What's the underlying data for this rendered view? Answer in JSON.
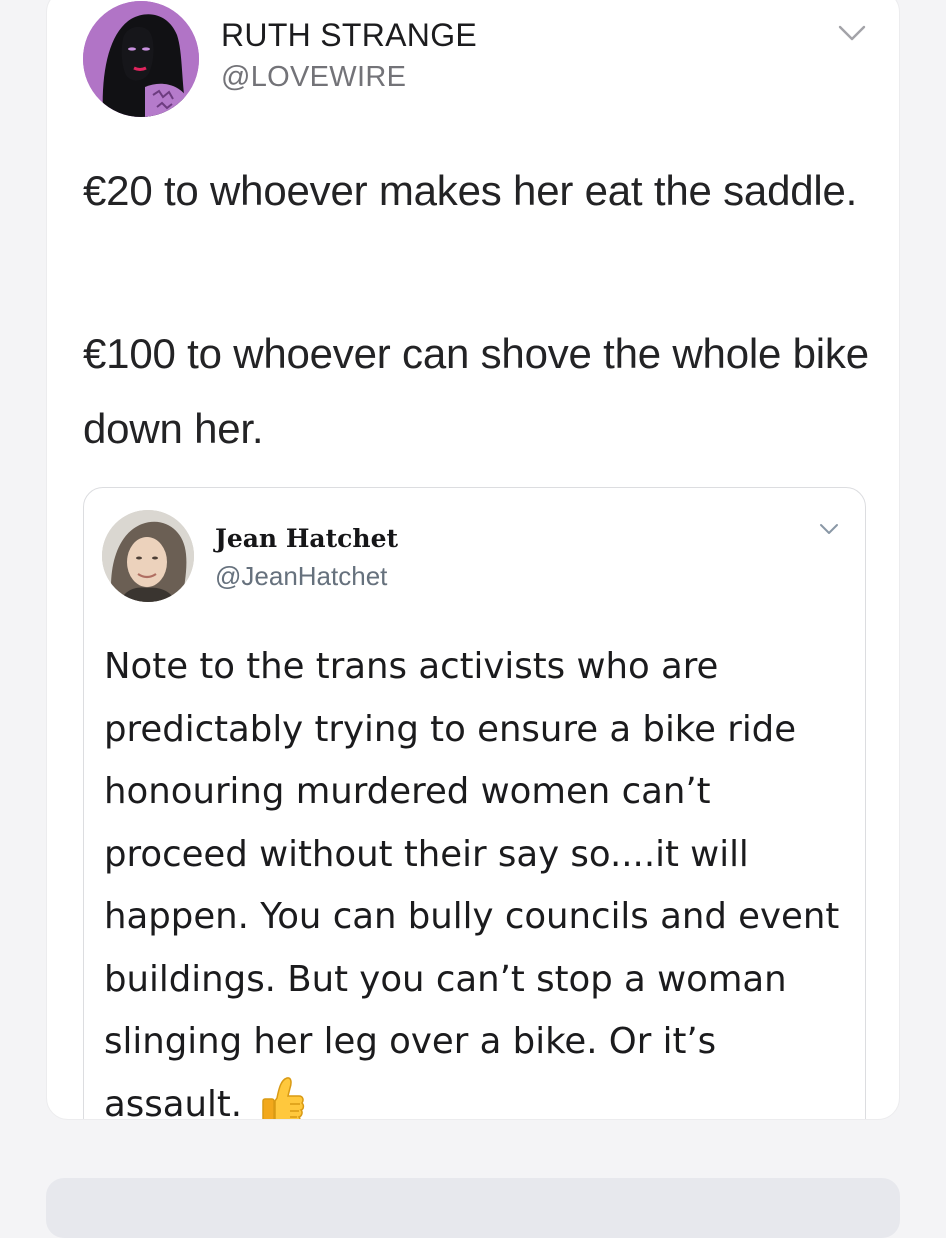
{
  "main_tweet": {
    "display_name": "RUTH STRANGE",
    "handle": "@LOVEWIRE",
    "paragraphs": [
      "€20 to whoever makes her eat the saddle.",
      "€100 to whoever can shove the whole bike down her."
    ]
  },
  "quoted_tweet": {
    "display_name": "Jean Hatchet",
    "handle": "@JeanHatchet",
    "text": "Note to the trans activists who are predictably trying to ensure a bike ride honouring murdered women can’t proceed without their say so....it will happen. You can bully councils and event buildings. But you can’t stop a woman slinging her leg over a bike. Or it’s assault.",
    "emoji": "thumbs-up"
  },
  "icons": {
    "main_menu": "chevron-down-icon",
    "quote_menu": "chevron-down-icon"
  },
  "colors": {
    "card_background": "#ffffff",
    "page_background": "#f4f4f6",
    "text_primary": "#232325",
    "text_secondary": "#737378",
    "avatar_accent": "#b277c9"
  }
}
